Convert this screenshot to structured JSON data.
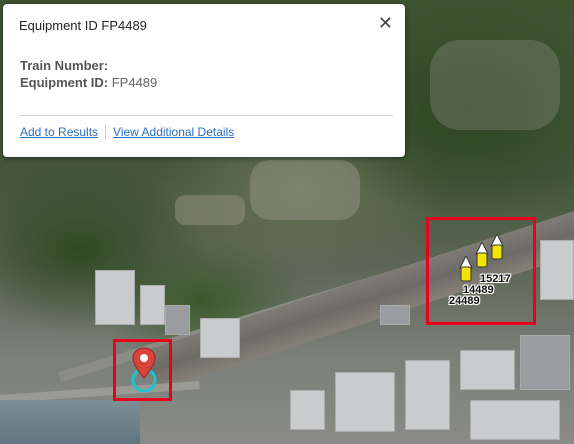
{
  "popup": {
    "title": "Equipment ID FP4489",
    "close_glyph": "✕",
    "fields": [
      {
        "label": "Train Number:",
        "value": ""
      },
      {
        "label": "Equipment ID:",
        "value": "FP4489"
      }
    ],
    "actions": {
      "add_to_results": "Add to Results",
      "view_details": "View Additional Details"
    }
  },
  "map": {
    "train_labels": [
      "15217",
      "14489",
      "24489"
    ],
    "highlight_color": "#e8001c",
    "marker_color": "#d9433a",
    "ring_color": "#19c4d4"
  }
}
